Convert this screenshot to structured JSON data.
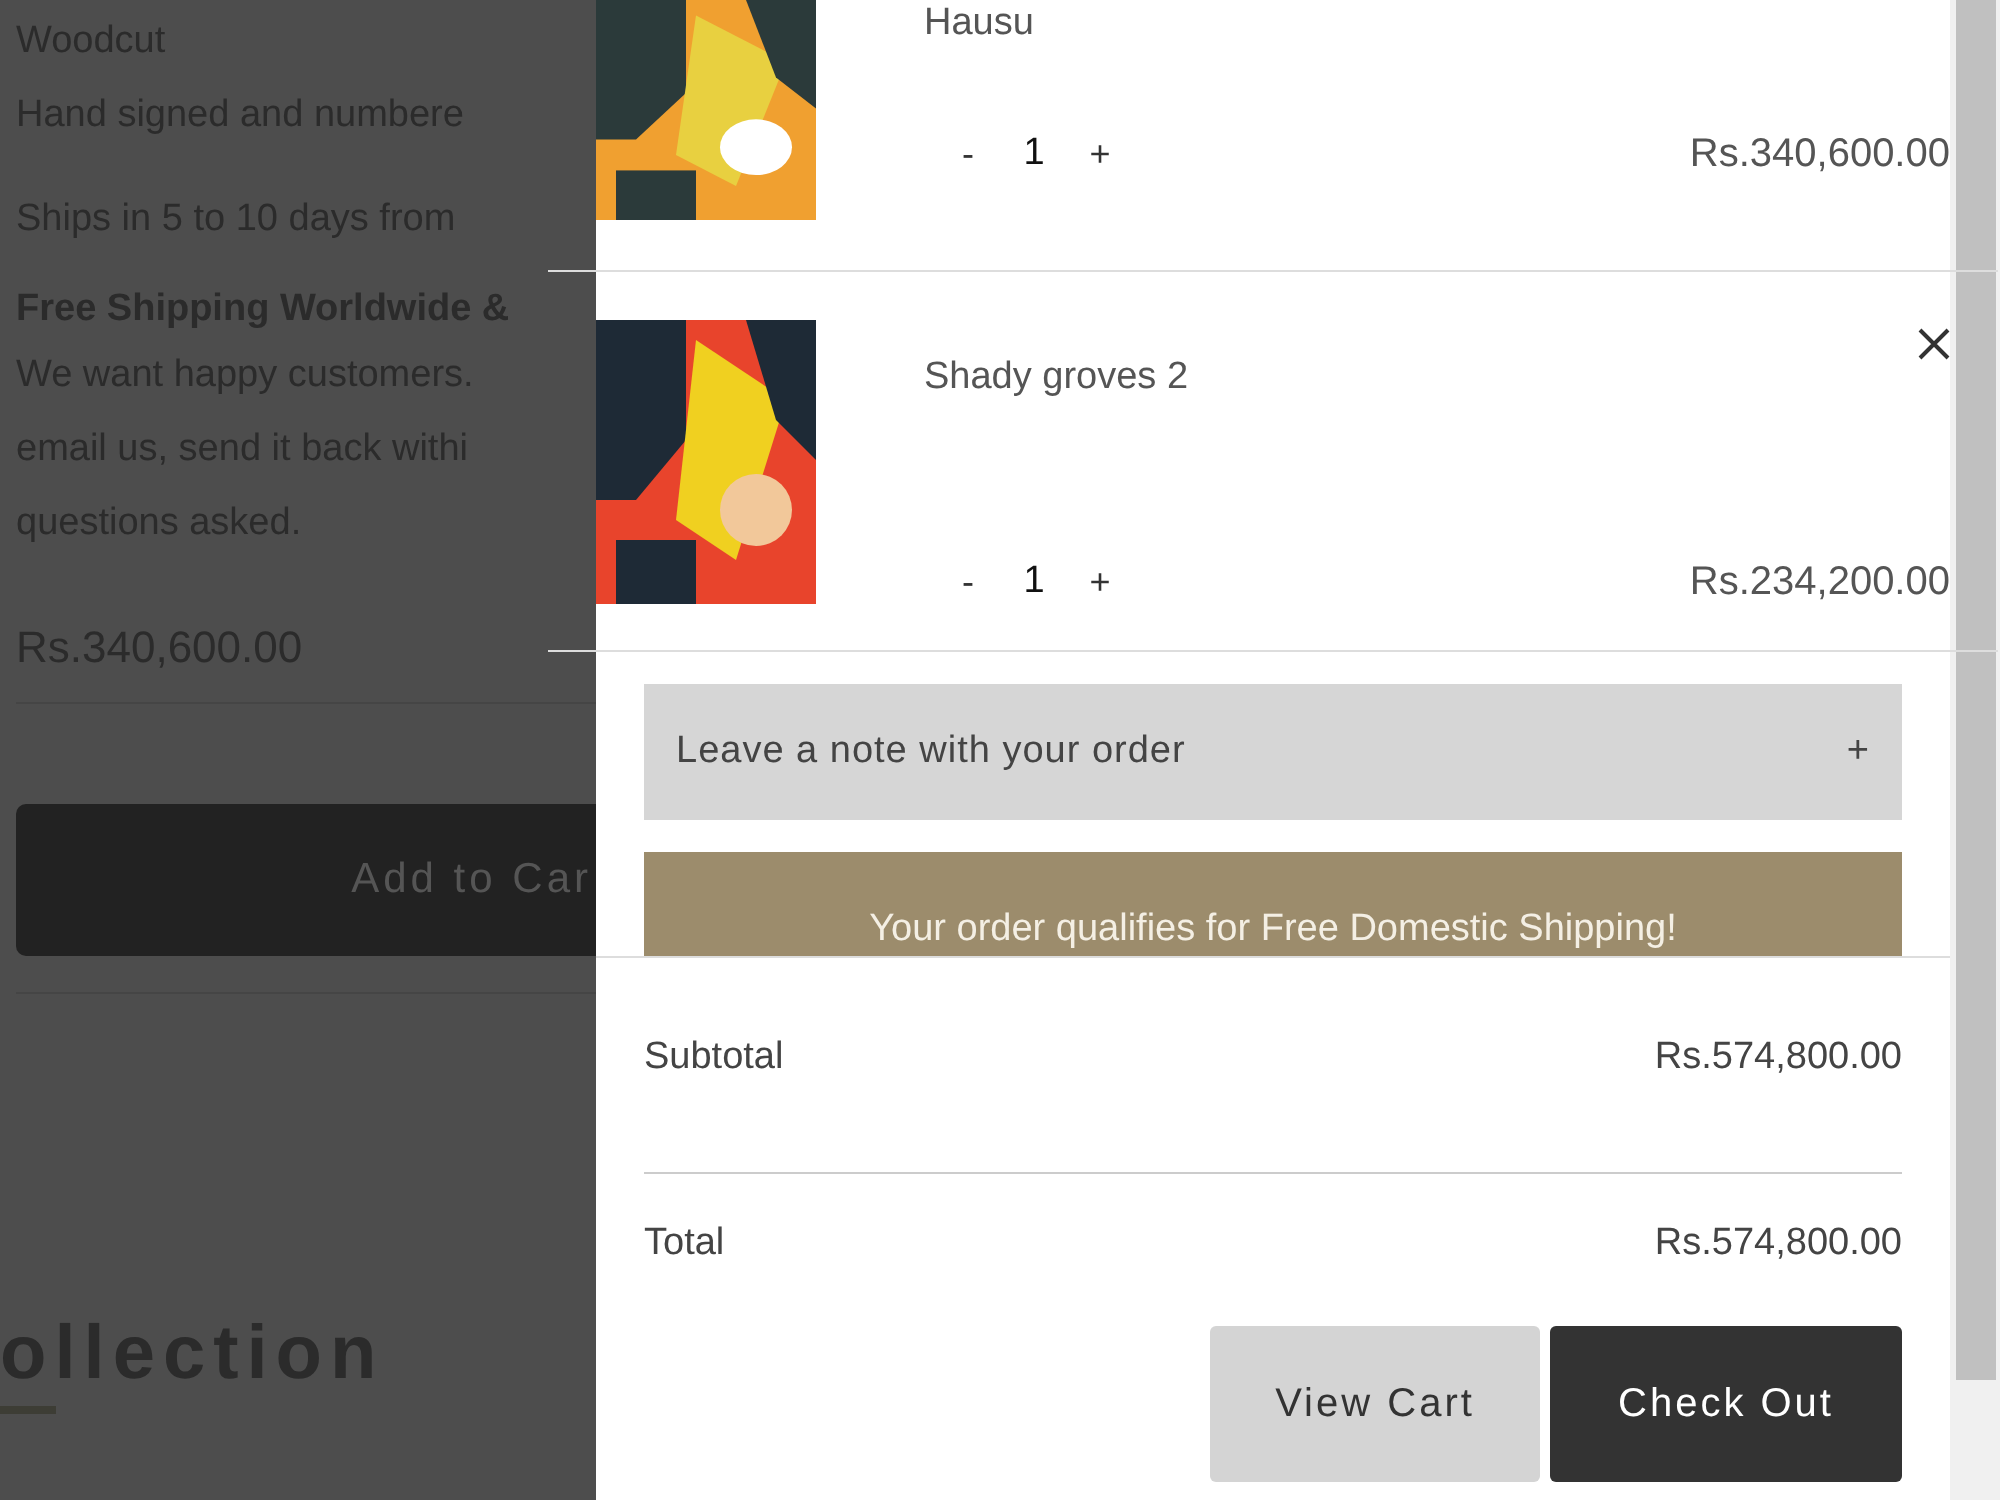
{
  "product_page": {
    "blocks": [
      {
        "lines": [
          "Woodcut",
          "Hand signed and numbere"
        ]
      },
      {
        "lines": [
          "Ships in 5 to 10 days from"
        ]
      },
      {
        "heading": "Free Shipping Worldwide &",
        "lines": [
          "We want happy customers.",
          "email us, send it back withi",
          "questions asked."
        ]
      }
    ],
    "price": "Rs.340,600.00",
    "add_button": "Add to Car",
    "section_heading": "ollection"
  },
  "cart": {
    "items": [
      {
        "title": "Hausu",
        "minus": "-",
        "quantity": "1",
        "plus": "+",
        "price": "Rs.340,600.00",
        "show_remove": false
      },
      {
        "title": "Shady groves 2",
        "minus": "-",
        "quantity": "1",
        "plus": "+",
        "price": "Rs.234,200.00",
        "show_remove": true
      }
    ],
    "note": {
      "label": "Leave a note with your order",
      "toggle": "+"
    },
    "banner": "Your order qualifies for Free Domestic Shipping!",
    "subtotal": {
      "label": "Subtotal",
      "value": "Rs.574,800.00"
    },
    "total": {
      "label": "Total",
      "value": "Rs.574,800.00"
    },
    "buttons": [
      {
        "label": "View Cart",
        "kind": "secondary"
      },
      {
        "label": "Check Out",
        "kind": "primary"
      }
    ]
  }
}
